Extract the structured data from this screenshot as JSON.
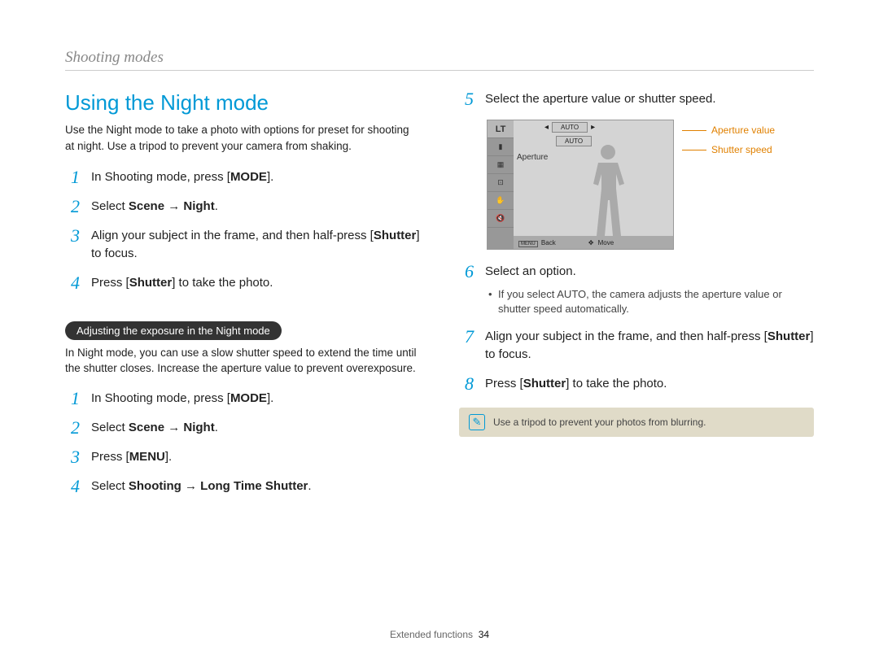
{
  "breadcrumb": "Shooting modes",
  "title": "Using the Night mode",
  "intro": "Use the Night mode to take a photo with options for preset for shooting at night. Use a tripod to prevent your camera from shaking.",
  "left_steps_a": [
    {
      "num": "1",
      "pre": "In Shooting mode, press [",
      "bold": "MODE",
      "post": "]."
    },
    {
      "num": "2",
      "pre": "Select ",
      "bold": "Scene → Night",
      "post": "."
    },
    {
      "num": "3",
      "pre": "Align your subject in the frame, and then half-press [",
      "bold": "Shutter",
      "post": "] to focus."
    },
    {
      "num": "4",
      "pre": "Press [",
      "bold": "Shutter",
      "post": "] to take the photo."
    }
  ],
  "subhead_pill": "Adjusting the exposure in the Night mode",
  "subhead_note": "In Night mode, you can use a slow shutter speed to extend the time until the shutter closes. Increase the aperture value to prevent overexposure.",
  "left_steps_b": [
    {
      "num": "1",
      "pre": "In Shooting mode, press [",
      "bold": "MODE",
      "post": "]."
    },
    {
      "num": "2",
      "pre": "Select ",
      "bold": "Scene → Night",
      "post": "."
    },
    {
      "num": "3",
      "pre": "Press [",
      "bold": "MENU",
      "post": "]."
    },
    {
      "num": "4",
      "pre": "Select ",
      "bold": "Shooting → Long Time Shutter",
      "post": "."
    }
  ],
  "right_step5": {
    "num": "5",
    "text": "Select the aperture value or shutter speed."
  },
  "camera_screen": {
    "sidebar_label": "LT",
    "auto1": "AUTO",
    "auto2": "AUTO",
    "aperture_label": "Aperture",
    "back_label": "Back",
    "move_label": "Move",
    "menu_label": "MENU"
  },
  "legend": {
    "aperture": "Aperture value",
    "shutter": "Shutter speed"
  },
  "right_step6": {
    "num": "6",
    "text": "Select an option."
  },
  "right_step6_bullet": {
    "pre": "If you select ",
    "bold": "AUTO",
    "post": ", the camera adjusts the aperture value or shutter speed automatically."
  },
  "right_step7": {
    "num": "7",
    "pre": "Align your subject in the frame, and then half-press [",
    "bold": "Shutter",
    "post": "] to focus."
  },
  "right_step8": {
    "num": "8",
    "pre": "Press [",
    "bold": "Shutter",
    "post": "] to take the photo."
  },
  "tip": "Use a tripod to prevent your photos from blurring.",
  "footer_section": "Extended functions",
  "footer_page": "34"
}
